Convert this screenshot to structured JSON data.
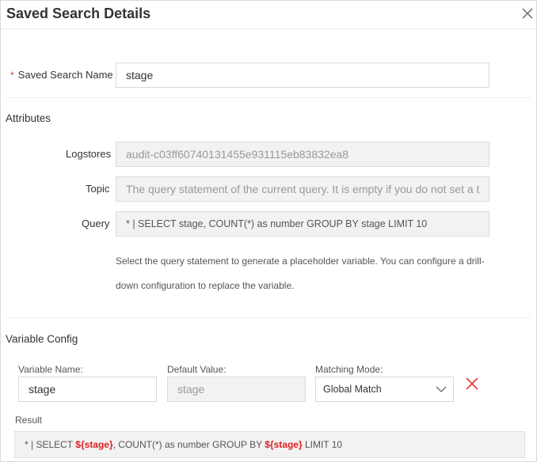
{
  "dialog": {
    "title": "Saved Search Details"
  },
  "name_field": {
    "required_mark": "*",
    "label": "Saved Search Name",
    "value": "stage"
  },
  "attributes": {
    "section_title": "Attributes",
    "logstores_label": "Logstores",
    "logstores_value": "audit-c03ff60740131455e931115eb83832ea8",
    "topic_label": "Topic",
    "topic_placeholder": "The query statement of the current query. It is empty if you do not set a t",
    "query_label": "Query",
    "query_value": "* | SELECT stage, COUNT(*) as number GROUP BY stage LIMIT 10",
    "helper_text": "Select the query statement to generate a placeholder variable. You can configure a drill-down configuration to replace the variable."
  },
  "variable_config": {
    "section_title": "Variable Config",
    "variable_name_label": "Variable Name:",
    "variable_name_value": "stage",
    "default_value_label": "Default Value:",
    "default_value_placeholder": "stage",
    "matching_mode_label": "Matching Mode:",
    "matching_mode_value": "Global Match",
    "result_label": "Result",
    "result_parts": {
      "p1": "* | SELECT ",
      "v1": "${stage}",
      "p2": ", COUNT(*) as number GROUP BY ",
      "v2": "${stage}",
      "p3": " LIMIT 10"
    }
  },
  "colors": {
    "accent_delete": "#e53935",
    "variable_highlight": "#e02020"
  }
}
